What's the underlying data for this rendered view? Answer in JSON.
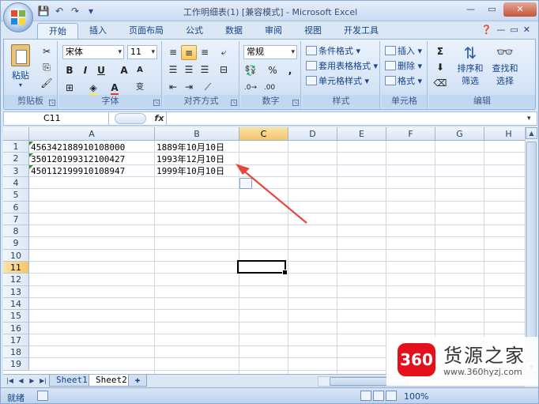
{
  "window": {
    "title": "工作明细表(1) [兼容模式] - Microsoft Excel"
  },
  "quick_access": {
    "icons": [
      "save-icon",
      "undo-icon",
      "redo-icon",
      "customize-icon"
    ]
  },
  "ribbon_tabs": [
    "开始",
    "插入",
    "页面布局",
    "公式",
    "数据",
    "审阅",
    "视图",
    "开发工具"
  ],
  "ribbon": {
    "clipboard": {
      "paste_label": "粘贴",
      "group_label": "剪贴板"
    },
    "font": {
      "font_name": "宋体",
      "font_size": "11",
      "bold": "B",
      "italic": "I",
      "underline": "U",
      "grow": "A",
      "shrink": "A",
      "phonetic": "变",
      "group_label": "字体"
    },
    "alignment": {
      "group_label": "对齐方式"
    },
    "number": {
      "format": "常规",
      "percent": "%",
      "comma": ",",
      "group_label": "数字"
    },
    "styles": {
      "conditional": "条件格式",
      "table": "套用表格格式",
      "cell": "单元格样式",
      "group_label": "样式"
    },
    "cells": {
      "insert": "插入",
      "delete": "删除",
      "format": "格式",
      "group_label": "单元格"
    },
    "editing": {
      "sum": "Σ",
      "sort_filter_1": "排序和",
      "sort_filter_2": "筛选",
      "find_select_1": "查找和",
      "find_select_2": "选择",
      "group_label": "编辑"
    }
  },
  "formula_bar": {
    "name_box": "C11",
    "fx": "fx",
    "value": ""
  },
  "grid": {
    "columns": [
      "A",
      "B",
      "C",
      "D",
      "E",
      "F",
      "G",
      "H"
    ],
    "selected_column": "C",
    "rows": [
      "1",
      "2",
      "3",
      "4",
      "5",
      "6",
      "7",
      "8",
      "9",
      "10",
      "11",
      "12",
      "13",
      "14",
      "15",
      "16",
      "17",
      "18",
      "19"
    ],
    "selected_row": "11",
    "cells": [
      {
        "a": "456342188910108000",
        "b": "1889年10月10日"
      },
      {
        "a": "350120199312100427",
        "b": "1993年12月10日"
      },
      {
        "a": "450112199910108947",
        "b": "1999年10月10日"
      }
    ],
    "active_cell": "C11"
  },
  "sheets": {
    "tabs": [
      "Sheet1",
      "Sheet2"
    ],
    "active": "Sheet2"
  },
  "status_bar": {
    "ready": "就绪",
    "zoom": "100%"
  },
  "watermark": {
    "badge": "360",
    "title": "货源之家",
    "url": "www.360hyzj.com"
  },
  "colors": {
    "arrow": "#e8473b",
    "selection_header": "#f6c56a"
  }
}
